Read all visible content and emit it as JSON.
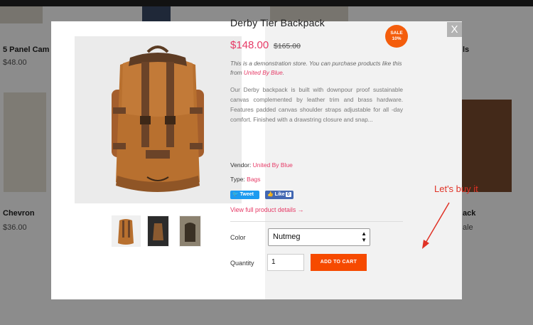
{
  "background": {
    "products": [
      {
        "title": "5 Panel Cam",
        "price": "$48.00"
      },
      {
        "title": "Chevron",
        "price": "$36.00"
      },
      {
        "title": "ack",
        "price": "ale"
      }
    ],
    "partial_text": "ls"
  },
  "modal": {
    "close_label": "X",
    "prev_arrow": "‹",
    "product": {
      "title": "Derby Tier Backpack",
      "sale_badge_line1": "SALE",
      "sale_badge_line2": "10%",
      "price": "$148.00",
      "compare_price": "$165.00",
      "demo_note": "This is a demonstration store. You can purchase products like this from ",
      "demo_note_link": "United By Blue",
      "demo_note_end": ".",
      "description": "Our Derby backpack is built with downpour proof sustainable canvas complemented by leather trim and brass hardware. Features padded canvas shoulder straps adjustable for all -day comfort. Finished with a drawstring closure and snap...",
      "vendor_label": "Vendor: ",
      "vendor": "United By Blue",
      "type_label": "Type: ",
      "type": "Bags",
      "tweet_label": "Tweet",
      "like_label": "Like",
      "like_count": "0",
      "full_details_link": "View full product details →",
      "color_label": "Color",
      "color_value": "Nutmeg",
      "quantity_label": "Quantity",
      "quantity_value": "1",
      "add_to_cart": "ADD TO CART"
    },
    "thumbnails": [
      "backpack-front",
      "backpack-dark",
      "backpack-side"
    ]
  },
  "annotation": {
    "text": "Let's buy it",
    "color": "#e03226"
  },
  "colors": {
    "accent": "#e63a66",
    "button": "#f64a00",
    "sale": "#f45d0c"
  }
}
